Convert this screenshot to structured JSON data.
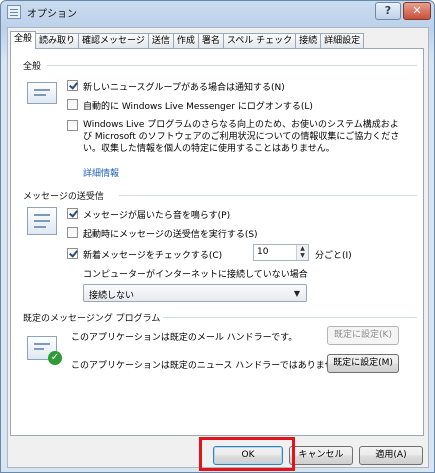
{
  "window": {
    "title": "オプション",
    "help_glyph": "?",
    "close_glyph": "✕"
  },
  "tabs": [
    "全般",
    "読み取り",
    "確認メッセージ",
    "送信",
    "作成",
    "署名",
    "スペル チェック",
    "接続",
    "詳細設定"
  ],
  "active_tab": "全般",
  "general": {
    "heading": "全般",
    "notify_new_groups": {
      "label": "新しいニュースグループがある場合は通知する(N)",
      "checked": true
    },
    "auto_logon": {
      "label": "自動的に Windows Live Messenger にログオンする(L)",
      "checked": false
    },
    "ceip": {
      "line1": "Windows Live プログラムのさらなる向上のため、お使いのシステム構成およ",
      "line2": "び Microsoft のソフトウェアのご利用状況についての情報収集にご協力くださ",
      "line3": "い。収集した情報を個人の特定に使用することはありません。",
      "checked": false
    },
    "details_link": "詳細情報"
  },
  "send_receive": {
    "heading": "メッセージの送受信",
    "play_sound": {
      "label": "メッセージが届いたら音を鳴らす(P)",
      "checked": true
    },
    "send_on_startup": {
      "label": "起動時にメッセージの送受信を実行する(S)",
      "checked": false
    },
    "check_new": {
      "label": "新着メッセージをチェックする(C)",
      "checked": true
    },
    "interval_value": "10",
    "interval_suffix": "分ごと(I)",
    "offline_label": "コンピューターがインターネットに接続していない場合",
    "offline_select": "接続しない"
  },
  "default_programs": {
    "heading": "既定のメッセージング プログラム",
    "mail_status": "このアプリケーションは既定のメール ハンドラーです。",
    "mail_button": "既定に設定(K)",
    "news_status": "このアプリケーションは既定のニュース ハンドラーではありません。",
    "news_button": "既定に設定(M)"
  },
  "footer": {
    "ok": "OK",
    "cancel": "キャンセル",
    "apply": "適用(A)"
  },
  "colors": {
    "highlight": "#e0141a",
    "link": "#1f5fbf"
  }
}
